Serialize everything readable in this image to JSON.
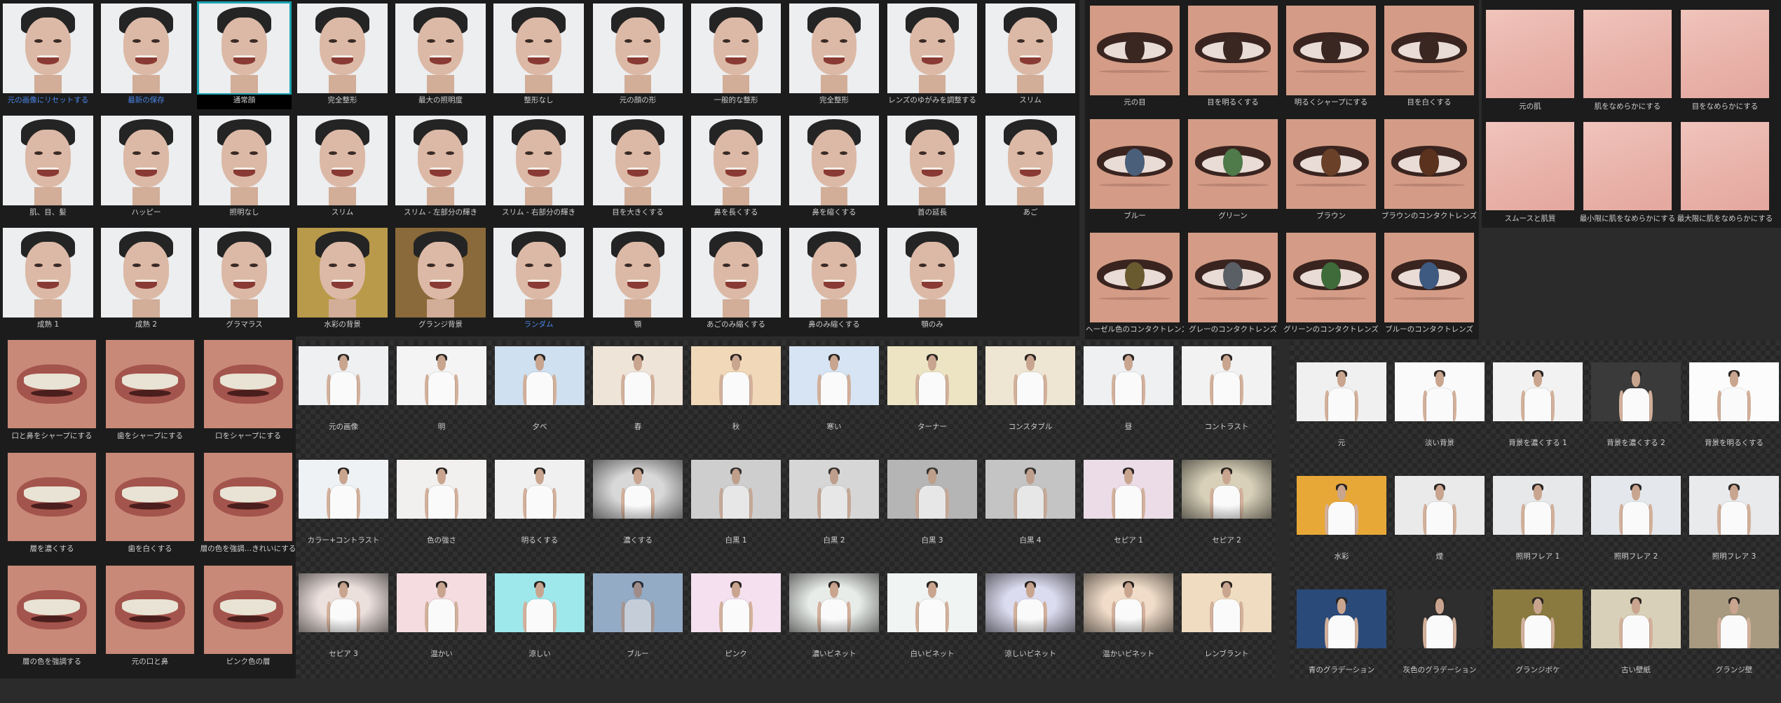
{
  "faces": {
    "groupA": [
      {
        "label": "元の画像にリセットする",
        "blue": true
      },
      {
        "label": "最新の保存",
        "blue": true
      },
      {
        "label": "通常顔",
        "selected": true
      },
      {
        "label": "完全整形"
      },
      {
        "label": "最大の照明度"
      },
      {
        "label": "整形なし"
      },
      {
        "label": "肌、目、髪"
      },
      {
        "label": "ハッピー"
      },
      {
        "label": "照明なし"
      },
      {
        "label": "スリム"
      },
      {
        "label": "スリム - 左部分の輝き"
      },
      {
        "label": "スリム - 右部分の輝き"
      },
      {
        "label": "成熟 1"
      },
      {
        "label": "成熟 2"
      },
      {
        "label": "グラマラス"
      },
      {
        "label": "水彩の背景",
        "tint": "#b99a4a"
      },
      {
        "label": "グランジ背景",
        "tint": "#8a6a3a"
      },
      {
        "label": "ランダム",
        "blue": true
      }
    ],
    "groupB": [
      {
        "label": "元の顔の形"
      },
      {
        "label": "一般的な整形"
      },
      {
        "label": "完全整形"
      },
      {
        "label": "レンズのゆがみを調整する"
      },
      {
        "label": "スリム"
      },
      {
        "label": "目を大きくする"
      },
      {
        "label": "鼻を長くする"
      },
      {
        "label": "鼻を縮くする"
      },
      {
        "label": "首の延長"
      },
      {
        "label": "あご"
      },
      {
        "label": "顎"
      },
      {
        "label": "あごのみ縮くする"
      },
      {
        "label": "鼻のみ縮くする"
      },
      {
        "label": "顎のみ"
      }
    ]
  },
  "eyes": [
    {
      "label": "元の目",
      "iris": "#3b2722"
    },
    {
      "label": "目を明るくする",
      "iris": "#3b2722"
    },
    {
      "label": "明るくシャープにする",
      "iris": "#3b2722"
    },
    {
      "label": "目を白くする",
      "iris": "#3b2722"
    },
    {
      "label": "ブルー",
      "iris": "#4a5f7a"
    },
    {
      "label": "グリーン",
      "iris": "#4f7a4a"
    },
    {
      "label": "ブラウン",
      "iris": "#6a4028"
    },
    {
      "label": "ブラウンのコンタクトレンズ",
      "iris": "#5a321e"
    },
    {
      "label": "ヘーゼル色のコンタクトレンズ",
      "iris": "#6a5a30"
    },
    {
      "label": "グレーのコンタクトレンズ",
      "iris": "#5a5f66"
    },
    {
      "label": "グリーンのコンタクトレンズ",
      "iris": "#3f6a3a"
    },
    {
      "label": "ブルーのコンタクトレンズ",
      "iris": "#3f5a80"
    }
  ],
  "skin": [
    {
      "label": "元の肌"
    },
    {
      "label": "肌をなめらかにする"
    },
    {
      "label": "目をなめらかにする"
    },
    {
      "label": "スムースと肌質"
    },
    {
      "label": "最小限に肌をなめらかにする"
    },
    {
      "label": "最大限に肌をなめらかにする"
    }
  ],
  "mouth": [
    {
      "label": "口と鼻をシャープにする"
    },
    {
      "label": "歯をシャープにする"
    },
    {
      "label": "口をシャープにする"
    },
    {
      "label": "層を濃くする"
    },
    {
      "label": "歯を白くする"
    },
    {
      "label": "層の色を強調…きれいにする"
    },
    {
      "label": "層の色を強調する"
    },
    {
      "label": "元の口と鼻"
    },
    {
      "label": "ピンク色の層"
    }
  ],
  "styles": [
    {
      "label": "元の画像",
      "bg": "#eef0f2",
      "ov": "none"
    },
    {
      "label": "明",
      "bg": "#f4f4f4",
      "ov": "none"
    },
    {
      "label": "夕べ",
      "bg": "#cfe0f0",
      "ov": "none"
    },
    {
      "label": "春",
      "bg": "#efe4d8",
      "ov": "none"
    },
    {
      "label": "秋",
      "bg": "#f0d8b8",
      "ov": "none"
    },
    {
      "label": "寒い",
      "bg": "#d6e4f4",
      "ov": "none"
    },
    {
      "label": "ターナー",
      "bg": "#ece4c2",
      "ov": "none"
    },
    {
      "label": "コンスタブル",
      "bg": "#eee6d2",
      "ov": "none"
    },
    {
      "label": "昼",
      "bg": "#eef0f2",
      "ov": "none"
    },
    {
      "label": "コントラスト",
      "bg": "#f2f2f2",
      "ov": "none"
    },
    {
      "label": "カラー+コントラスト",
      "bg": "#eef2f4",
      "ov": "none"
    },
    {
      "label": "色の強さ",
      "bg": "#f2f0ee",
      "ov": "none"
    },
    {
      "label": "明るくする",
      "bg": "#f0f0f0",
      "ov": "none"
    },
    {
      "label": "濃くする",
      "bg": "#d8d8d8",
      "ov": "vignette"
    },
    {
      "label": "白黒 1",
      "bg": "#dcdcdc",
      "ov": "gray"
    },
    {
      "label": "白黒 2",
      "bg": "#e6e6e6",
      "ov": "gray"
    },
    {
      "label": "白黒 3",
      "bg": "#bfbfbf",
      "ov": "gray"
    },
    {
      "label": "白黒 4",
      "bg": "#d0d0d0",
      "ov": "gray"
    },
    {
      "label": "セピア 1",
      "bg": "#ecdce8",
      "ov": "none"
    },
    {
      "label": "セピア 2",
      "bg": "#d8d0b8",
      "ov": "vignette"
    },
    {
      "label": "セピア 3",
      "bg": "#ece0dc",
      "ov": "vignette"
    },
    {
      "label": "温かい",
      "bg": "#f4dce0",
      "ov": "none"
    },
    {
      "label": "涼しい",
      "bg": "#9ee8ec",
      "ov": "none"
    },
    {
      "label": "ブルー",
      "bg": "#b8cde0",
      "ov": "blue"
    },
    {
      "label": "ピンク",
      "bg": "#f4e0ee",
      "ov": "none"
    },
    {
      "label": "濃いビネット",
      "bg": "#e8ece8",
      "ov": "vignette"
    },
    {
      "label": "白いビネット",
      "bg": "#f0f4f2",
      "ov": "none"
    },
    {
      "label": "涼しいビネット",
      "bg": "#dcdcf0",
      "ov": "vignette"
    },
    {
      "label": "温かいビネット",
      "bg": "#f0dcc8",
      "ov": "vignette"
    },
    {
      "label": "レンブラント",
      "bg": "#f0dcc0",
      "ov": "none"
    }
  ],
  "backgrounds": [
    {
      "label": "元",
      "bg": "#f0f0f0"
    },
    {
      "label": "淡い背景",
      "bg": "#fafafa"
    },
    {
      "label": "背景を濃くする 1",
      "bg": "#f2f2f2"
    },
    {
      "label": "背景を濃くする 2",
      "bg": "#3a3a3a"
    },
    {
      "label": "背景を明るくする",
      "bg": "#fcfcfc"
    },
    {
      "label": "水彩",
      "bg": "#e8a838"
    },
    {
      "label": "煙",
      "bg": "#eaeaea"
    },
    {
      "label": "照明フレア 1",
      "bg": "#e6e8ea"
    },
    {
      "label": "照明フレア 2",
      "bg": "#e4e8ec"
    },
    {
      "label": "照明フレア 3",
      "bg": "#e8eaec"
    },
    {
      "label": "青のグラデーション",
      "bg": "#2a4a7a"
    },
    {
      "label": "灰色のグラデーション",
      "bg": "#2e2e2e"
    },
    {
      "label": "グランジボケ",
      "bg": "#8a7a40"
    },
    {
      "label": "古い壁紙",
      "bg": "#d8d0b8"
    },
    {
      "label": "グランジ壁",
      "bg": "#a89a80"
    }
  ]
}
